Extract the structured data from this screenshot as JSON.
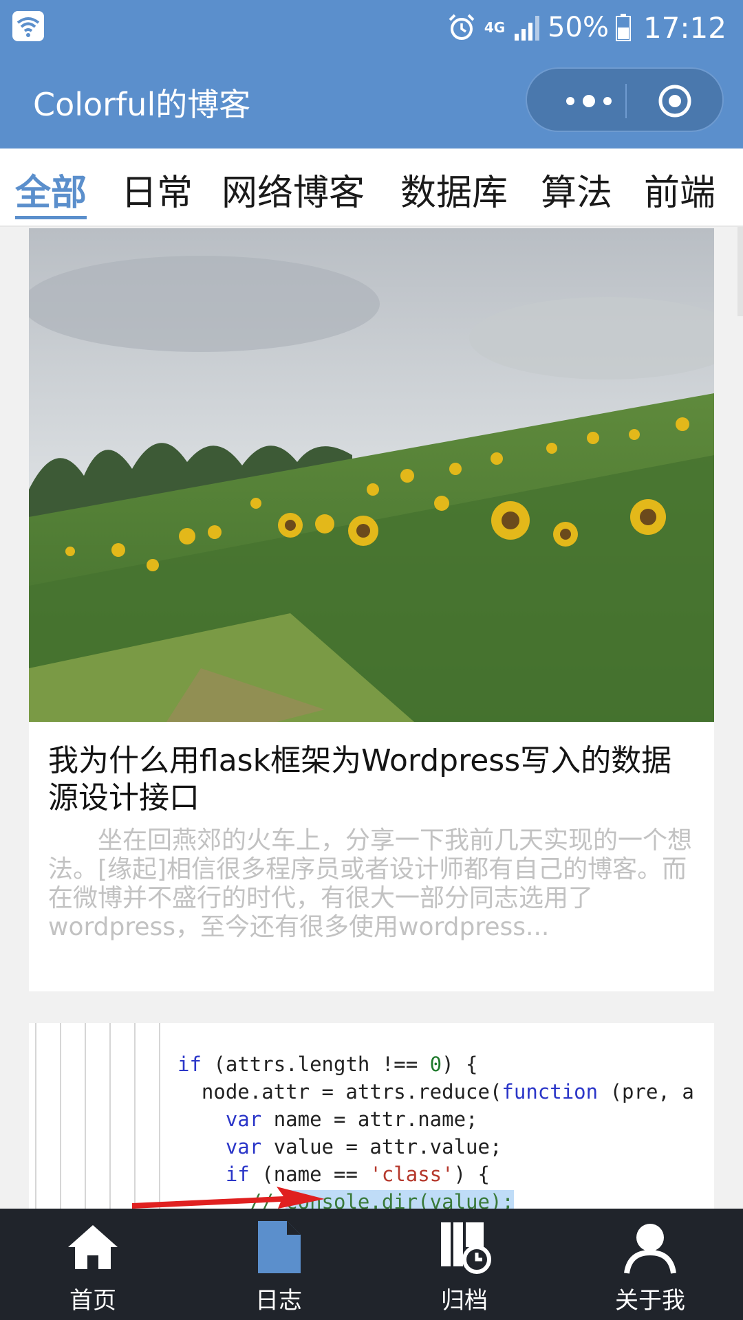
{
  "status_bar": {
    "network": "4G",
    "battery": "50%",
    "time": "17:12",
    "icons": [
      "wifi-icon",
      "alarm-icon",
      "signal-icon",
      "battery-icon"
    ]
  },
  "header": {
    "title": "Colorful的博客",
    "menu_icon": "more-dots-icon",
    "close_icon": "close-circle-icon"
  },
  "categories": {
    "items": [
      "全部",
      "日常",
      "网络博客",
      "数据库",
      "算法",
      "前端"
    ],
    "active": "全部"
  },
  "posts": [
    {
      "image": "sunflower-field-photo",
      "title": "我为什么用flask框架为Wordpress写入的数据源设计接口",
      "excerpt": "坐在回燕郊的火车上，分享一下我前几天实现的一个想法。[缘起]相信很多程序员或者设计师都有自己的博客。而在微博并不盛行的时代，有很大一部分同志选用了wordpress，至今还有很多使用wordpress..."
    },
    {
      "image": "code-screenshot",
      "code_lines": [
        "if (attrs.length !== 0) {",
        "  node.attr = attrs.reduce(function (pre, a",
        "    var name = attr.name;",
        "    var value = attr.value;",
        "    if (name == 'class') {",
        "      // console.dir(value);"
      ]
    }
  ],
  "tab_bar": {
    "items": [
      {
        "label": "首页",
        "icon": "home-icon"
      },
      {
        "label": "日志",
        "icon": "document-icon"
      },
      {
        "label": "归档",
        "icon": "archive-icon"
      },
      {
        "label": "关于我",
        "icon": "user-icon"
      }
    ],
    "active": "日志"
  },
  "colors": {
    "primary": "#5b8fcc",
    "tabbar_bg": "#20242b",
    "excerpt": "#c2c2c2"
  }
}
